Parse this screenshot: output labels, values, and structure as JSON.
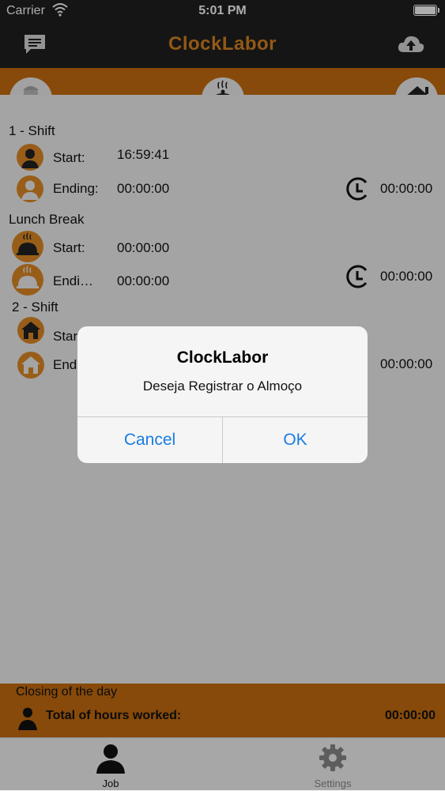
{
  "status_bar": {
    "carrier": "Carrier",
    "time": "5:01 PM"
  },
  "nav": {
    "title": "ClockLabor",
    "left_icon": "chat-icon",
    "right_icon": "cloud-upload-icon"
  },
  "tabs_top": [
    "worker-icon",
    "lunch-tray-icon",
    "house-icon"
  ],
  "shift1": {
    "title": "1 - Shift",
    "start_label": "Start:",
    "start_value": "16:59:41",
    "end_label": "Ending:",
    "end_value": "00:00:00",
    "duration": "00:00:00"
  },
  "lunch": {
    "title": "Lunch Break",
    "start_label": "Start:",
    "start_value": "00:00:00",
    "end_label": "Endi…",
    "end_value": "00:00:00",
    "duration": "00:00:00"
  },
  "shift2": {
    "title": "2 - Shift",
    "start_label": "Star",
    "end_label": "End",
    "duration": "00:00:00"
  },
  "closing": {
    "title": "Closing of the day",
    "total_label": "Total of hours worked:",
    "total_value": "00:00:00"
  },
  "tabbar": {
    "job": "Job",
    "settings": "Settings"
  },
  "dialog": {
    "title": "ClockLabor",
    "message": "Deseja Registrar o Almoço",
    "cancel": "Cancel",
    "ok": "OK"
  },
  "colors": {
    "accent": "#c76e10",
    "dark": "#1f1f1f",
    "link": "#1a7de0"
  }
}
